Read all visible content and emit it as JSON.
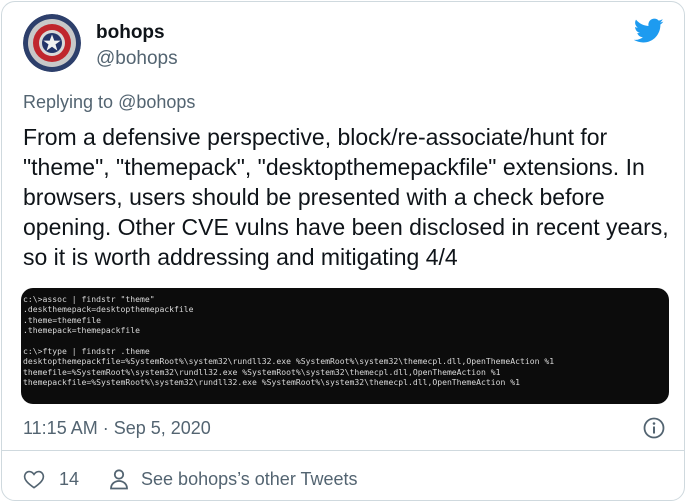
{
  "author": {
    "display_name": "bohops",
    "handle": "@bohops"
  },
  "reply": {
    "prefix": "Replying to",
    "mention": "@bohops"
  },
  "tweet": {
    "text": "From a defensive perspective, block/re-associate/hunt for \"theme\", \"themepack\", \"desktopthemepackfile\" extensions. In browsers, users should be presented with a check before opening. Other CVE vulns have been disclosed in recent years, so it is worth addressing and mitigating 4/4"
  },
  "terminal": {
    "lines": [
      "c:\\>assoc | findstr \"theme\"",
      ".deskthemepack=desktopthemepackfile",
      ".theme=themefile",
      ".themepack=themepackfile",
      "",
      "c:\\>ftype | findstr .theme",
      "desktopthemepackfile=%SystemRoot%\\system32\\rundll32.exe %SystemRoot%\\system32\\themecpl.dll,OpenThemeAction %1",
      "themefile=%SystemRoot%\\system32\\rundll32.exe %SystemRoot%\\system32\\themecpl.dll,OpenThemeAction %1",
      "themepackfile=%SystemRoot%\\system32\\rundll32.exe %SystemRoot%\\system32\\themecpl.dll,OpenThemeAction %1"
    ]
  },
  "meta": {
    "timestamp": "11:15 AM · Sep 5, 2020"
  },
  "actions": {
    "like_count": "14",
    "other_tweets_label": "See bohops’s other Tweets"
  },
  "colors": {
    "twitter_blue": "#1d9bf0",
    "muted_text": "#536471",
    "main_text": "#0f1419",
    "terminal_bg": "#0c0c0c"
  },
  "icons": {
    "avatar": "captain-america-shield",
    "brand": "twitter-bird-icon",
    "info": "info-icon",
    "like": "heart-icon",
    "profile": "person-icon"
  }
}
